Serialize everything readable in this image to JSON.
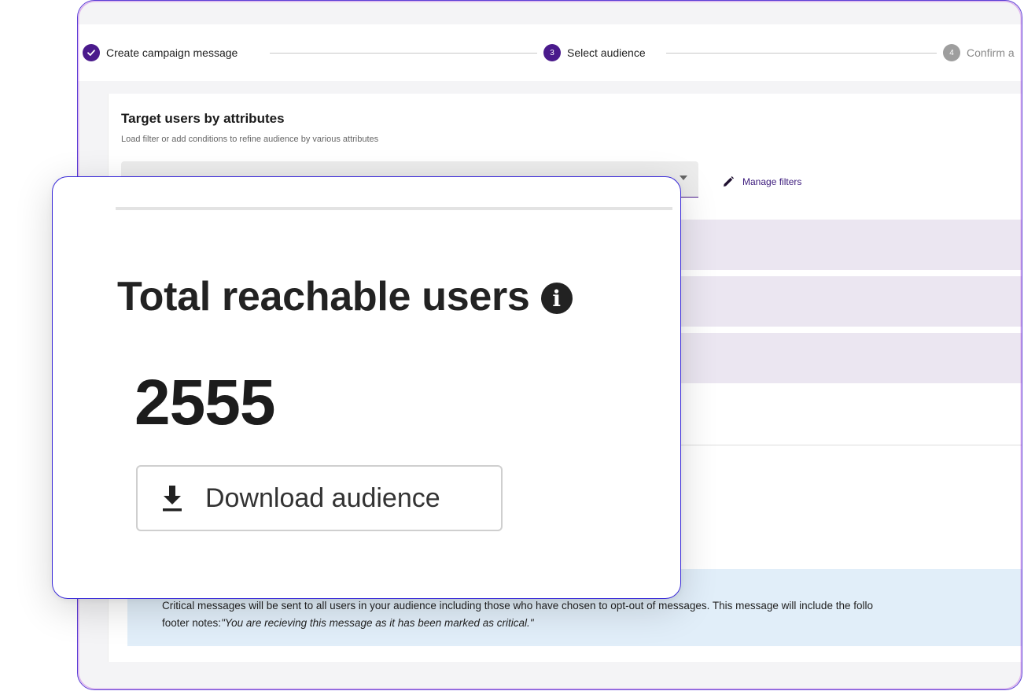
{
  "stepper": {
    "steps": [
      {
        "label": "Create campaign message",
        "state": "done"
      },
      {
        "label": "Select audience",
        "number": "3",
        "state": "active"
      },
      {
        "label": "Confirm a",
        "number": "4",
        "state": "pending"
      }
    ]
  },
  "targeting": {
    "title": "Target users by attributes",
    "subtitle": "Load filter or add conditions to refine audience by various attributes",
    "manage_filters_label": "Manage filters"
  },
  "reach": {
    "title": "Total reachable users",
    "info_icon": "i",
    "count": "2555",
    "download_label": "Download audience"
  },
  "notice": {
    "text": "Critical messages will be sent to all users in your audience including those who have chosen to opt-out of messages. This message will include the follo",
    "footer_prefix": "footer notes:",
    "footer_quote": "\"You are recieving this message as it has been marked as critical.\""
  },
  "colors": {
    "accent": "#4a1a8c",
    "frame_border": "#5b3fd6",
    "condition_row": "#ebe6f1",
    "notice_bg": "#e1eef9"
  },
  "icons": [
    "check-icon",
    "pencil-icon",
    "info-icon",
    "download-icon",
    "dropdown-arrow-icon"
  ]
}
